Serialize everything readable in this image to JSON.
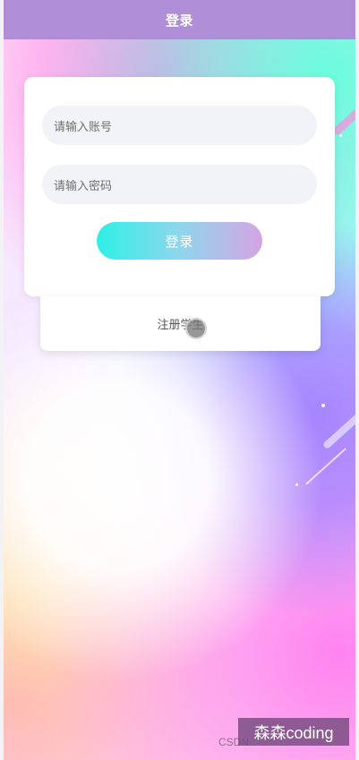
{
  "header": {
    "title": "登录"
  },
  "login_form": {
    "account_placeholder": "请输入账号",
    "password_placeholder": "请输入密码",
    "login_button": "登录"
  },
  "register": {
    "label": "注册学生"
  },
  "footer": {
    "csdn_text": "CSDN",
    "watermark_text": "森森coding"
  }
}
